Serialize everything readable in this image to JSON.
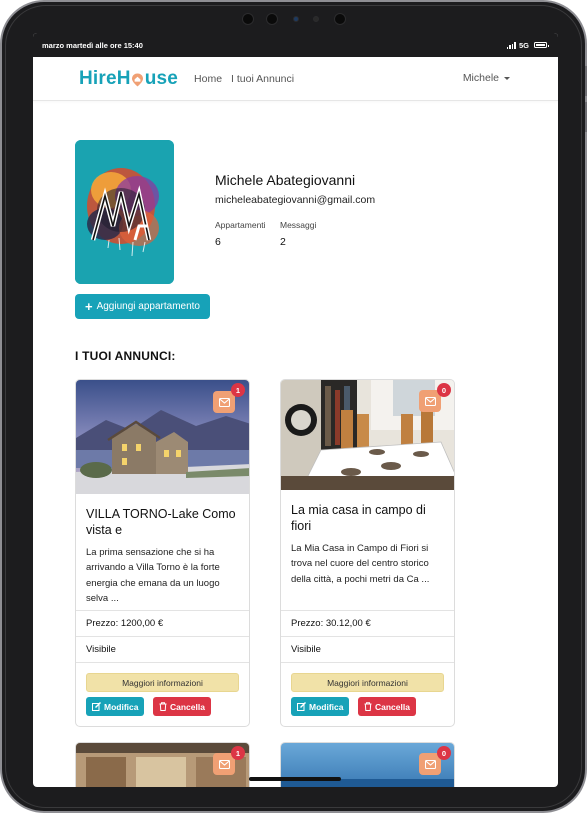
{
  "status_bar": {
    "time_text": "marzo martedì alle ore 15:40",
    "network": "5G"
  },
  "navbar": {
    "brand": {
      "prefix": "HireH",
      "suffix": "use"
    },
    "links": [
      "Home",
      "I tuoi Annunci"
    ],
    "user": "Michele"
  },
  "profile": {
    "name": "Michele Abategiovanni",
    "email": "micheleabategiovanni@gmail.com",
    "stats": [
      {
        "label": "Appartamenti",
        "value": "6"
      },
      {
        "label": "Messaggi",
        "value": "2"
      }
    ],
    "add_button": "Aggiungi appartamento"
  },
  "listings_section": {
    "title": "I TUOI ANNUNCI:",
    "cards": [
      {
        "title": "VILLA TORNO-Lake Como vista e",
        "description": "La prima sensazione che si ha arrivando a Villa Torno è la forte energia che emana da un luogo selva ...",
        "price": "Prezzo: 1200,00 €",
        "visibility": "Visibile",
        "message_count": "1",
        "info_button": "Maggiori informazioni",
        "edit_button": "Modifica",
        "delete_button": "Cancella"
      },
      {
        "title": "La mia casa in campo di fiori",
        "description": "La Mia Casa in Campo di Fiori si trova nel cuore del centro storico della città, a pochi metri da Ca ...",
        "price": "Prezzo: 30.12,00 €",
        "visibility": "Visibile",
        "message_count": "0",
        "info_button": "Maggiori informazioni",
        "edit_button": "Modifica",
        "delete_button": "Cancella"
      }
    ],
    "more_cards_badges": [
      "1",
      "0"
    ]
  },
  "colors": {
    "primary": "#17a2b8",
    "danger": "#dc3545",
    "warning_light": "#f1e2a8",
    "message_button": "#f0a074"
  }
}
